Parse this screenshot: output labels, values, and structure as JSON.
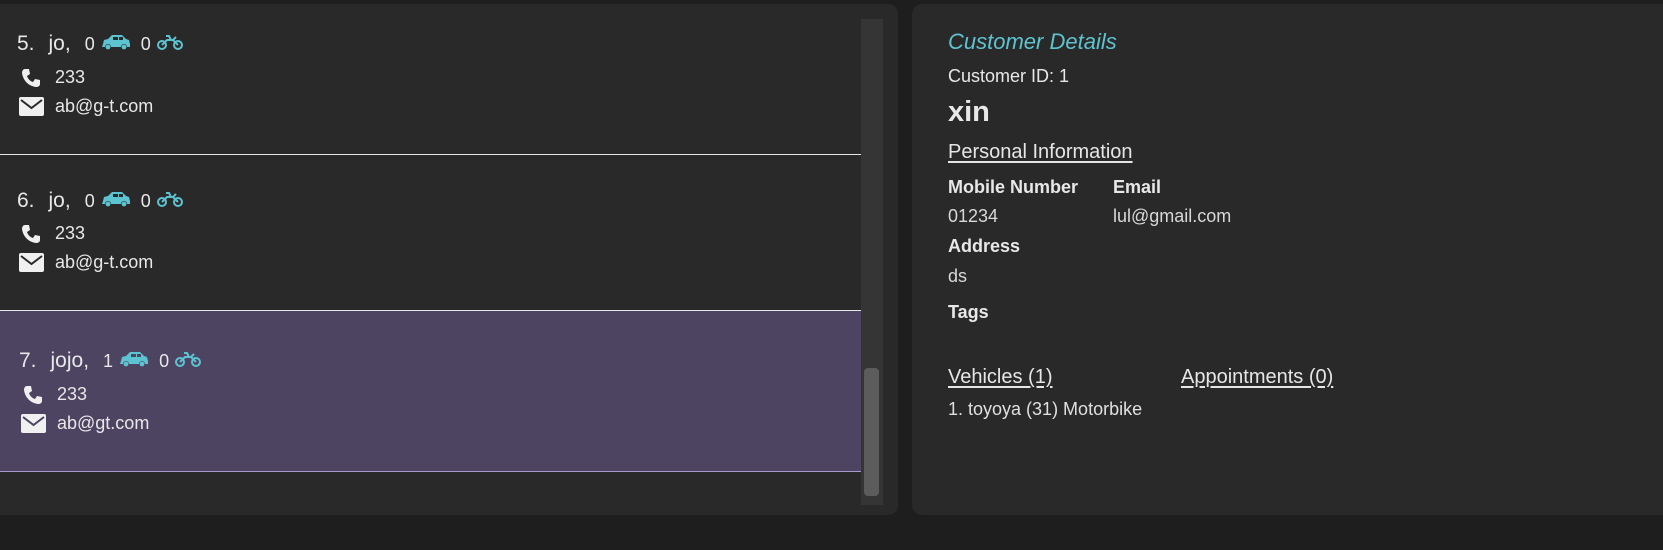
{
  "customer_list": [
    {
      "index": "5.",
      "name": "jo,",
      "car_count": "0",
      "bike_count": "0",
      "phone": "233",
      "email": "ab@g-t.com",
      "selected": false
    },
    {
      "index": "6.",
      "name": "jo,",
      "car_count": "0",
      "bike_count": "0",
      "phone": "233",
      "email": "ab@g-t.com",
      "selected": false
    },
    {
      "index": "7.",
      "name": "jojo,",
      "car_count": "1",
      "bike_count": "0",
      "phone": "233",
      "email": "ab@gt.com",
      "selected": true
    }
  ],
  "icons": {
    "car": "car-icon",
    "bike": "motorbike-icon",
    "phone": "phone-icon",
    "email": "envelope-icon"
  },
  "colors": {
    "accent": "#5ec3d0",
    "selected_row": "#4d4462",
    "panel": "#292929",
    "background": "#1e1e1e"
  },
  "details": {
    "heading": "Customer Details",
    "customer_id": "Customer ID: 1",
    "name": "xin",
    "personal_info_title": "Personal Information",
    "mobile_label": "Mobile Number",
    "mobile_value": "01234",
    "email_label": "Email",
    "email_value": "lul@gmail.com",
    "address_label": "Address",
    "address_value": "ds",
    "tags_label": "Tags",
    "vehicles_title": "Vehicles (1)",
    "appointments_title": "Appointments (0)",
    "vehicles": [
      "1. toyoya (31) Motorbike"
    ]
  }
}
